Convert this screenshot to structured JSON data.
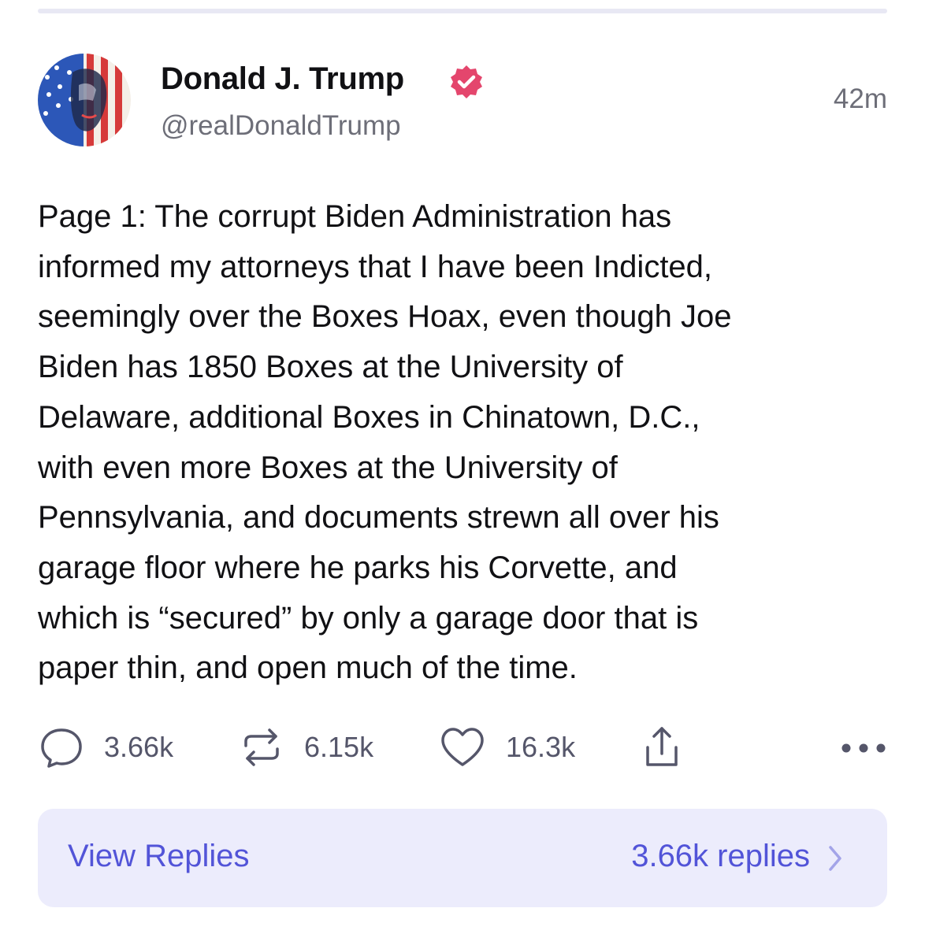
{
  "post": {
    "display_name": "Donald J. Trump",
    "handle": "@realDonaldTrump",
    "timestamp": "42m",
    "verified": true,
    "verified_badge_color": "#e4466d",
    "text": "Page 1: The corrupt Biden Administration has\ninformed my attorneys that I have been Indicted,\nseemingly over the Boxes Hoax, even though Joe\nBiden has 1850 Boxes at the University of\nDelaware, additional Boxes in Chinatown, D.C.,\nwith even more Boxes at the University of\nPennsylvania, and documents strewn all over his\ngarage floor where he parks his Corvette, and\nwhich is “secured” by only a garage door that is\npaper thin, and open much of the time."
  },
  "actions": {
    "replies": {
      "icon": "comment-icon",
      "count": "3.66k"
    },
    "reposts": {
      "icon": "repost-icon",
      "count": "6.15k"
    },
    "likes": {
      "icon": "heart-icon",
      "count": "16.3k"
    },
    "share": {
      "icon": "share-icon"
    },
    "more": {
      "icon": "more-icon"
    }
  },
  "replies_bar": {
    "label": "View Replies",
    "count_label": "3.66k replies",
    "accent_color": "#5254d8",
    "background_color": "#ececfc"
  }
}
